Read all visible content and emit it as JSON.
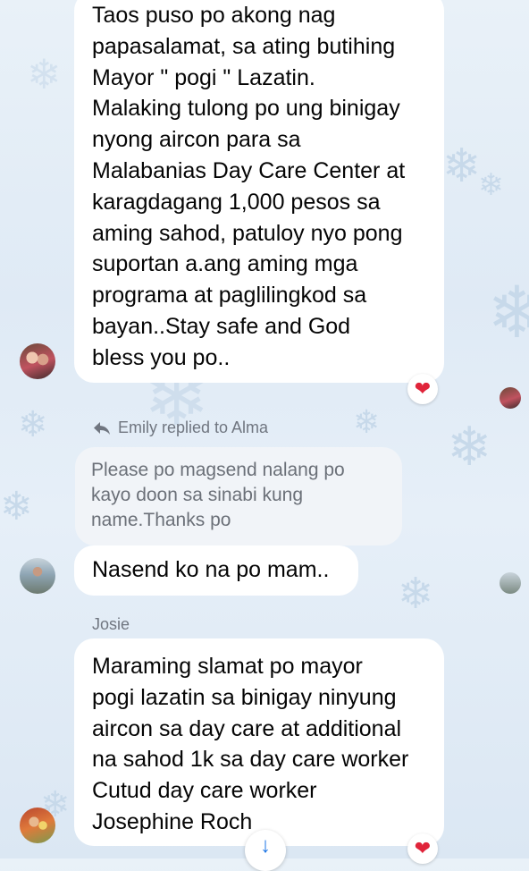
{
  "messages": [
    {
      "lines": [
        "Taos puso po akong nag",
        "papasalamat, sa ating butihing",
        "Mayor \" pogi \" Lazatin.",
        "Malaking tulong po ung binigay",
        "nyong aircon para sa",
        "Malabanias Day Care Center at",
        "karagdagang 1,000 pesos sa",
        "aming sahod, patuloy nyo pong",
        "suportan a.ang aming mga",
        "programa at paglilingkod sa",
        "bayan..Stay safe  and God",
        "bless you po.."
      ],
      "reaction": "heart"
    },
    {
      "reply_header": "Emily replied to Alma",
      "quoted_lines": [
        "Please po magsend nalang po",
        "kayo doon sa sinabi kung",
        "name.Thanks po"
      ],
      "text": "Nasend ko na po mam.."
    },
    {
      "sender": "Josie",
      "lines": [
        "Maraming slamat po mayor",
        "pogi  lazatin sa binigay ninyung",
        "aircon sa day care at additional",
        "na sahod 1k sa day care worker",
        "Cutud day care worker",
        "Josephine Roch"
      ],
      "reaction": "heart"
    }
  ],
  "icons": {
    "reply": "reply-arrow-icon",
    "heart": "heart-icon",
    "scroll_down": "arrow-down-icon"
  },
  "colors": {
    "heart": "#e0243a",
    "accent": "#1b74e4",
    "bubble": "#ffffff",
    "quoted_bubble": "#f1f4f8"
  }
}
